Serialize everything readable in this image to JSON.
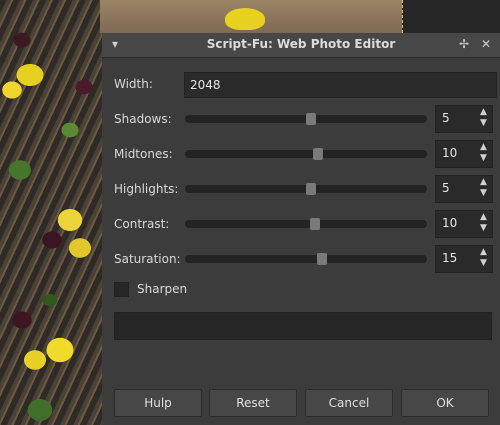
{
  "window": {
    "title": "Script-Fu: Web Photo Editor",
    "menu_icon": "chevron-down-icon",
    "pin_icon": "pin-icon",
    "close_icon": "close-icon"
  },
  "fields": {
    "width": {
      "label": "Width:",
      "value": "2048"
    },
    "sliders": [
      {
        "label": "Shadows:",
        "value": "5",
        "fraction": 0.52
      },
      {
        "label": "Midtones:",
        "value": "10",
        "fraction": 0.55
      },
      {
        "label": "Highlights:",
        "value": "5",
        "fraction": 0.52
      },
      {
        "label": "Contrast:",
        "value": "10",
        "fraction": 0.54
      },
      {
        "label": "Saturation:",
        "value": "15",
        "fraction": 0.57
      }
    ],
    "sharpen": {
      "label": "Sharpen",
      "checked": false
    }
  },
  "buttons": {
    "help": "Hulp",
    "reset": "Reset",
    "cancel": "Cancel",
    "ok": "OK"
  },
  "colors": {
    "dialog_bg": "#3c3c3c",
    "field_bg": "#2a2a2a",
    "button_bg": "#474747"
  }
}
